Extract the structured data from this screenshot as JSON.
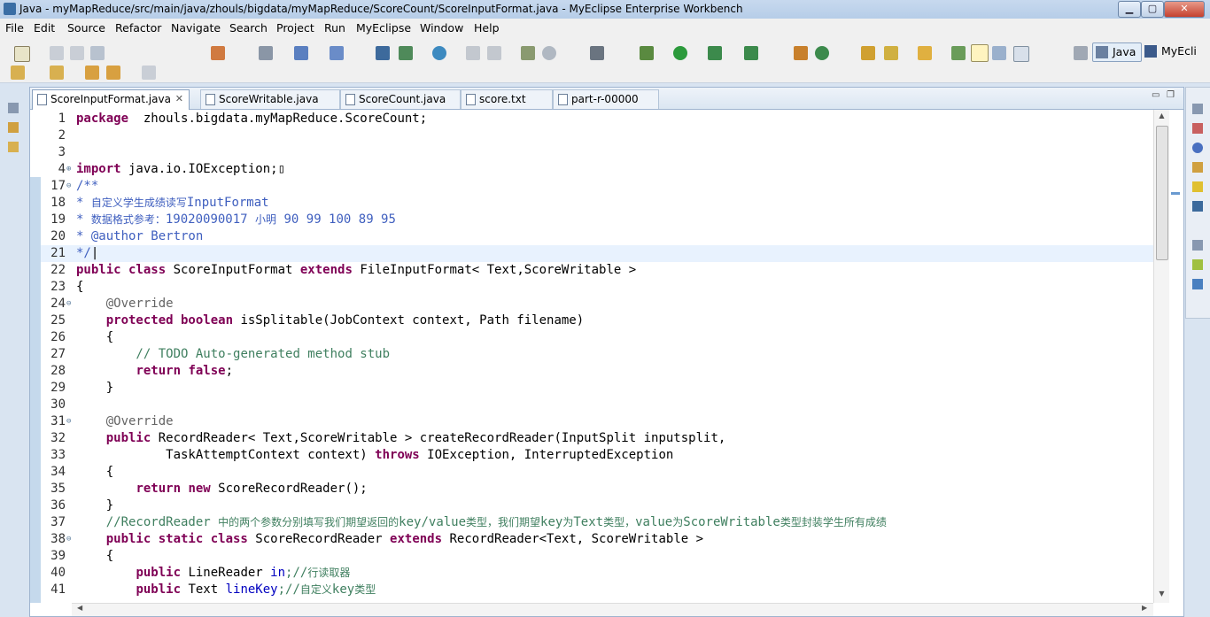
{
  "window": {
    "title": "Java - myMapReduce/src/main/java/zhouls/bigdata/myMapReduce/ScoreCount/ScoreInputFormat.java - MyEclipse Enterprise Workbench",
    "min_symbol": "▁",
    "max_symbol": "▢",
    "close_symbol": "✕"
  },
  "menu": [
    "File",
    "Edit",
    "Source",
    "Refactor",
    "Navigate",
    "Search",
    "Project",
    "Run",
    "MyEclipse",
    "Window",
    "Help"
  ],
  "perspectives": {
    "java": "Java",
    "myeclipse": "MyEcli"
  },
  "tabs": [
    {
      "label": "ScoreInputFormat.java",
      "active": true,
      "close": "✕"
    },
    {
      "label": "ScoreWritable.java"
    },
    {
      "label": "ScoreCount.java"
    },
    {
      "label": "score.txt"
    },
    {
      "label": "part-r-00000"
    }
  ],
  "editor_controls": {
    "minimize": "▭",
    "maximize": "❐"
  },
  "code": [
    {
      "n": "1",
      "parts": [
        [
          "kw",
          "package"
        ],
        [
          "",
          "  zhouls.bigdata.myMapReduce.ScoreCount;"
        ]
      ]
    },
    {
      "n": "2",
      "parts": []
    },
    {
      "n": "3",
      "parts": []
    },
    {
      "n": "4",
      "fold": "⊕",
      "parts": [
        [
          "kw",
          "import"
        ],
        [
          "",
          " java.io.IOException;▯"
        ]
      ]
    },
    {
      "n": "17",
      "fold": "⊖",
      "parts": [
        [
          "jd",
          "/**"
        ]
      ]
    },
    {
      "n": "18",
      "parts": [
        [
          "jd",
          "* "
        ],
        [
          "jd cjk",
          "自定义学生成绩读写"
        ],
        [
          "jd",
          "InputFormat"
        ]
      ]
    },
    {
      "n": "19",
      "parts": [
        [
          "jd",
          "* "
        ],
        [
          "jd cjk",
          "数据格式参考："
        ],
        [
          "jd",
          "19020090017 "
        ],
        [
          "jd cjk",
          "小明"
        ],
        [
          "jd",
          " 90 99 100 89 95"
        ]
      ]
    },
    {
      "n": "20",
      "parts": [
        [
          "jd",
          "* @author Bertron"
        ]
      ]
    },
    {
      "n": "21",
      "cur": true,
      "parts": [
        [
          "jd",
          "*/"
        ],
        [
          "",
          "|"
        ]
      ]
    },
    {
      "n": "22",
      "parts": [
        [
          "kw",
          "public class"
        ],
        [
          "",
          " ScoreInputFormat "
        ],
        [
          "kw",
          "extends"
        ],
        [
          "",
          " FileInputFormat< Text,ScoreWritable >"
        ]
      ]
    },
    {
      "n": "23",
      "parts": [
        [
          "",
          "{"
        ]
      ]
    },
    {
      "n": "24",
      "fold": "⊖",
      "parts": [
        [
          "an",
          "    @Override"
        ]
      ]
    },
    {
      "n": "25",
      "parts": [
        [
          "",
          "    "
        ],
        [
          "kw",
          "protected boolean"
        ],
        [
          "",
          " isSplitable(JobContext context, Path filename)"
        ]
      ]
    },
    {
      "n": "26",
      "parts": [
        [
          "",
          "    {"
        ]
      ]
    },
    {
      "n": "27",
      "parts": [
        [
          "cm",
          "        // "
        ],
        [
          "cm",
          "TODO"
        ],
        [
          "cm",
          " Auto-generated method stub"
        ]
      ]
    },
    {
      "n": "28",
      "parts": [
        [
          "",
          "        "
        ],
        [
          "kw",
          "return false"
        ],
        [
          "",
          ";"
        ]
      ]
    },
    {
      "n": "29",
      "parts": [
        [
          "",
          "    }"
        ]
      ]
    },
    {
      "n": "30",
      "parts": []
    },
    {
      "n": "31",
      "fold": "⊖",
      "parts": [
        [
          "an",
          "    @Override"
        ]
      ]
    },
    {
      "n": "32",
      "parts": [
        [
          "",
          "    "
        ],
        [
          "kw",
          "public"
        ],
        [
          "",
          " RecordReader< Text,ScoreWritable > createRecordReader(InputSplit inputsplit,"
        ]
      ]
    },
    {
      "n": "33",
      "parts": [
        [
          "",
          "            TaskAttemptContext context) "
        ],
        [
          "kw",
          "throws"
        ],
        [
          "",
          " IOException, InterruptedException"
        ]
      ]
    },
    {
      "n": "34",
      "parts": [
        [
          "",
          "    {"
        ]
      ]
    },
    {
      "n": "35",
      "parts": [
        [
          "",
          "        "
        ],
        [
          "kw",
          "return new"
        ],
        [
          "",
          " ScoreRecordReader();"
        ]
      ]
    },
    {
      "n": "36",
      "parts": [
        [
          "",
          "    }"
        ]
      ]
    },
    {
      "n": "37",
      "parts": [
        [
          "cm",
          "    //RecordReader "
        ],
        [
          "cm cjk",
          "中的两个参数分别填写我们期望返回的"
        ],
        [
          "cm",
          "key/value"
        ],
        [
          "cm cjk",
          "类型，我们期望"
        ],
        [
          "cm",
          "key"
        ],
        [
          "cm cjk",
          "为"
        ],
        [
          "cm",
          "Text"
        ],
        [
          "cm cjk",
          "类型，"
        ],
        [
          "cm",
          "value"
        ],
        [
          "cm cjk",
          "为"
        ],
        [
          "cm",
          "ScoreWritable"
        ],
        [
          "cm cjk",
          "类型封装学生所有成绩"
        ]
      ]
    },
    {
      "n": "38",
      "fold": "⊖",
      "parts": [
        [
          "",
          "    "
        ],
        [
          "kw",
          "public static class"
        ],
        [
          "",
          " ScoreRecordReader "
        ],
        [
          "kw",
          "extends"
        ],
        [
          "",
          " RecordReader<Text, ScoreWritable >"
        ]
      ]
    },
    {
      "n": "39",
      "parts": [
        [
          "",
          "    {"
        ]
      ]
    },
    {
      "n": "40",
      "parts": [
        [
          "",
          "        "
        ],
        [
          "kw",
          "public"
        ],
        [
          "",
          " LineReader "
        ],
        [
          "fld",
          "in"
        ],
        [
          "cm",
          ";//"
        ],
        [
          "cm cjk",
          "行读取器"
        ]
      ]
    },
    {
      "n": "41",
      "parts": [
        [
          "",
          "        "
        ],
        [
          "kw",
          "public"
        ],
        [
          "",
          " Text "
        ],
        [
          "fld",
          "lineKey"
        ],
        [
          "cm",
          ";//"
        ],
        [
          "cm cjk",
          "自定义"
        ],
        [
          "cm",
          "key"
        ],
        [
          "cm cjk",
          "类型"
        ]
      ]
    }
  ]
}
